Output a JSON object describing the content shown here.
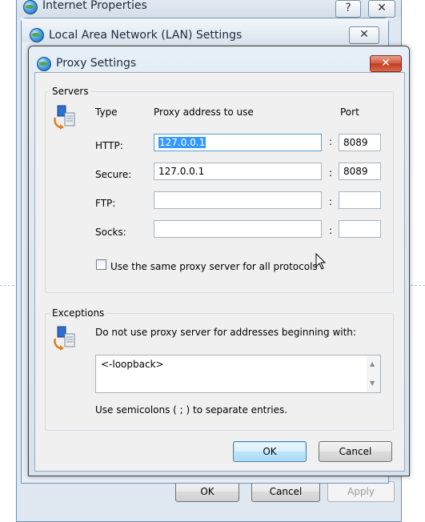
{
  "background_window": {
    "title": "Internet Properties",
    "help_glyph": "?",
    "close_glyph": "✕",
    "buttons": {
      "ok": "OK",
      "cancel": "Cancel",
      "apply": "Apply"
    }
  },
  "lan_window": {
    "title": "Local Area Network (LAN) Settings",
    "close_glyph": "✕"
  },
  "dialog": {
    "title": "Proxy Settings",
    "close_glyph": "✕",
    "servers": {
      "group_label": "Servers",
      "col_type": "Type",
      "col_address": "Proxy address to use",
      "col_port": "Port",
      "colon": ":",
      "rows": [
        {
          "label": "HTTP:",
          "address": "127.0.0.1",
          "port": "8089",
          "address_selected": true
        },
        {
          "label": "Secure:",
          "address": "127.0.0.1",
          "port": "8089",
          "address_selected": false
        },
        {
          "label": "FTP:",
          "address": "",
          "port": "",
          "address_selected": false
        },
        {
          "label": "Socks:",
          "address": "",
          "port": "",
          "address_selected": false
        }
      ],
      "same_proxy_label": "Use the same proxy server for all protocols",
      "same_proxy_checked": false
    },
    "exceptions": {
      "group_label": "Exceptions",
      "description": "Do not use proxy server for addresses beginning with:",
      "value": "<-loopback>",
      "hint": "Use semicolons ( ; ) to separate entries."
    },
    "buttons": {
      "ok": "OK",
      "cancel": "Cancel"
    }
  },
  "colors": {
    "selection": "#3399ff",
    "close_button": "#c0391c",
    "default_button_border": "#3c7fb1"
  }
}
